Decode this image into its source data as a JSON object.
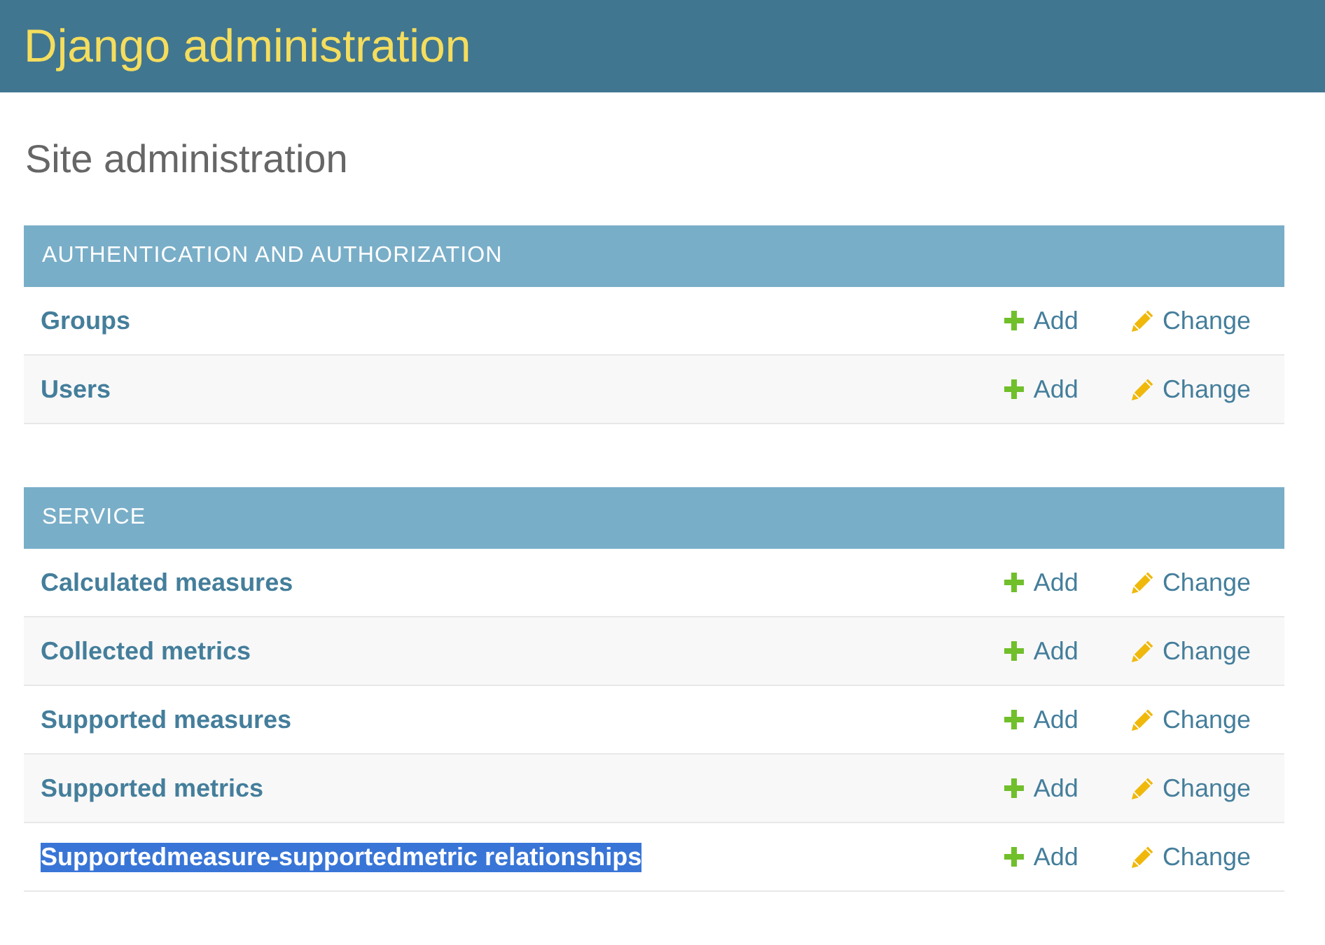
{
  "header": {
    "title": "Django administration"
  },
  "page_title": "Site administration",
  "modules": [
    {
      "caption": "AUTHENTICATION AND AUTHORIZATION",
      "models": [
        {
          "name": "Groups",
          "add": "Add",
          "change": "Change",
          "text_selected": false
        },
        {
          "name": "Users",
          "add": "Add",
          "change": "Change",
          "text_selected": false
        }
      ]
    },
    {
      "caption": "SERVICE",
      "models": [
        {
          "name": "Calculated measures",
          "add": "Add",
          "change": "Change",
          "text_selected": false
        },
        {
          "name": "Collected metrics",
          "add": "Add",
          "change": "Change",
          "text_selected": false
        },
        {
          "name": "Supported measures",
          "add": "Add",
          "change": "Change",
          "text_selected": false
        },
        {
          "name": "Supported metrics",
          "add": "Add",
          "change": "Change",
          "text_selected": false
        },
        {
          "name": "Supportedmeasure-supportedmetric relationships",
          "add": "Add",
          "change": "Change",
          "text_selected": true
        }
      ]
    }
  ]
}
